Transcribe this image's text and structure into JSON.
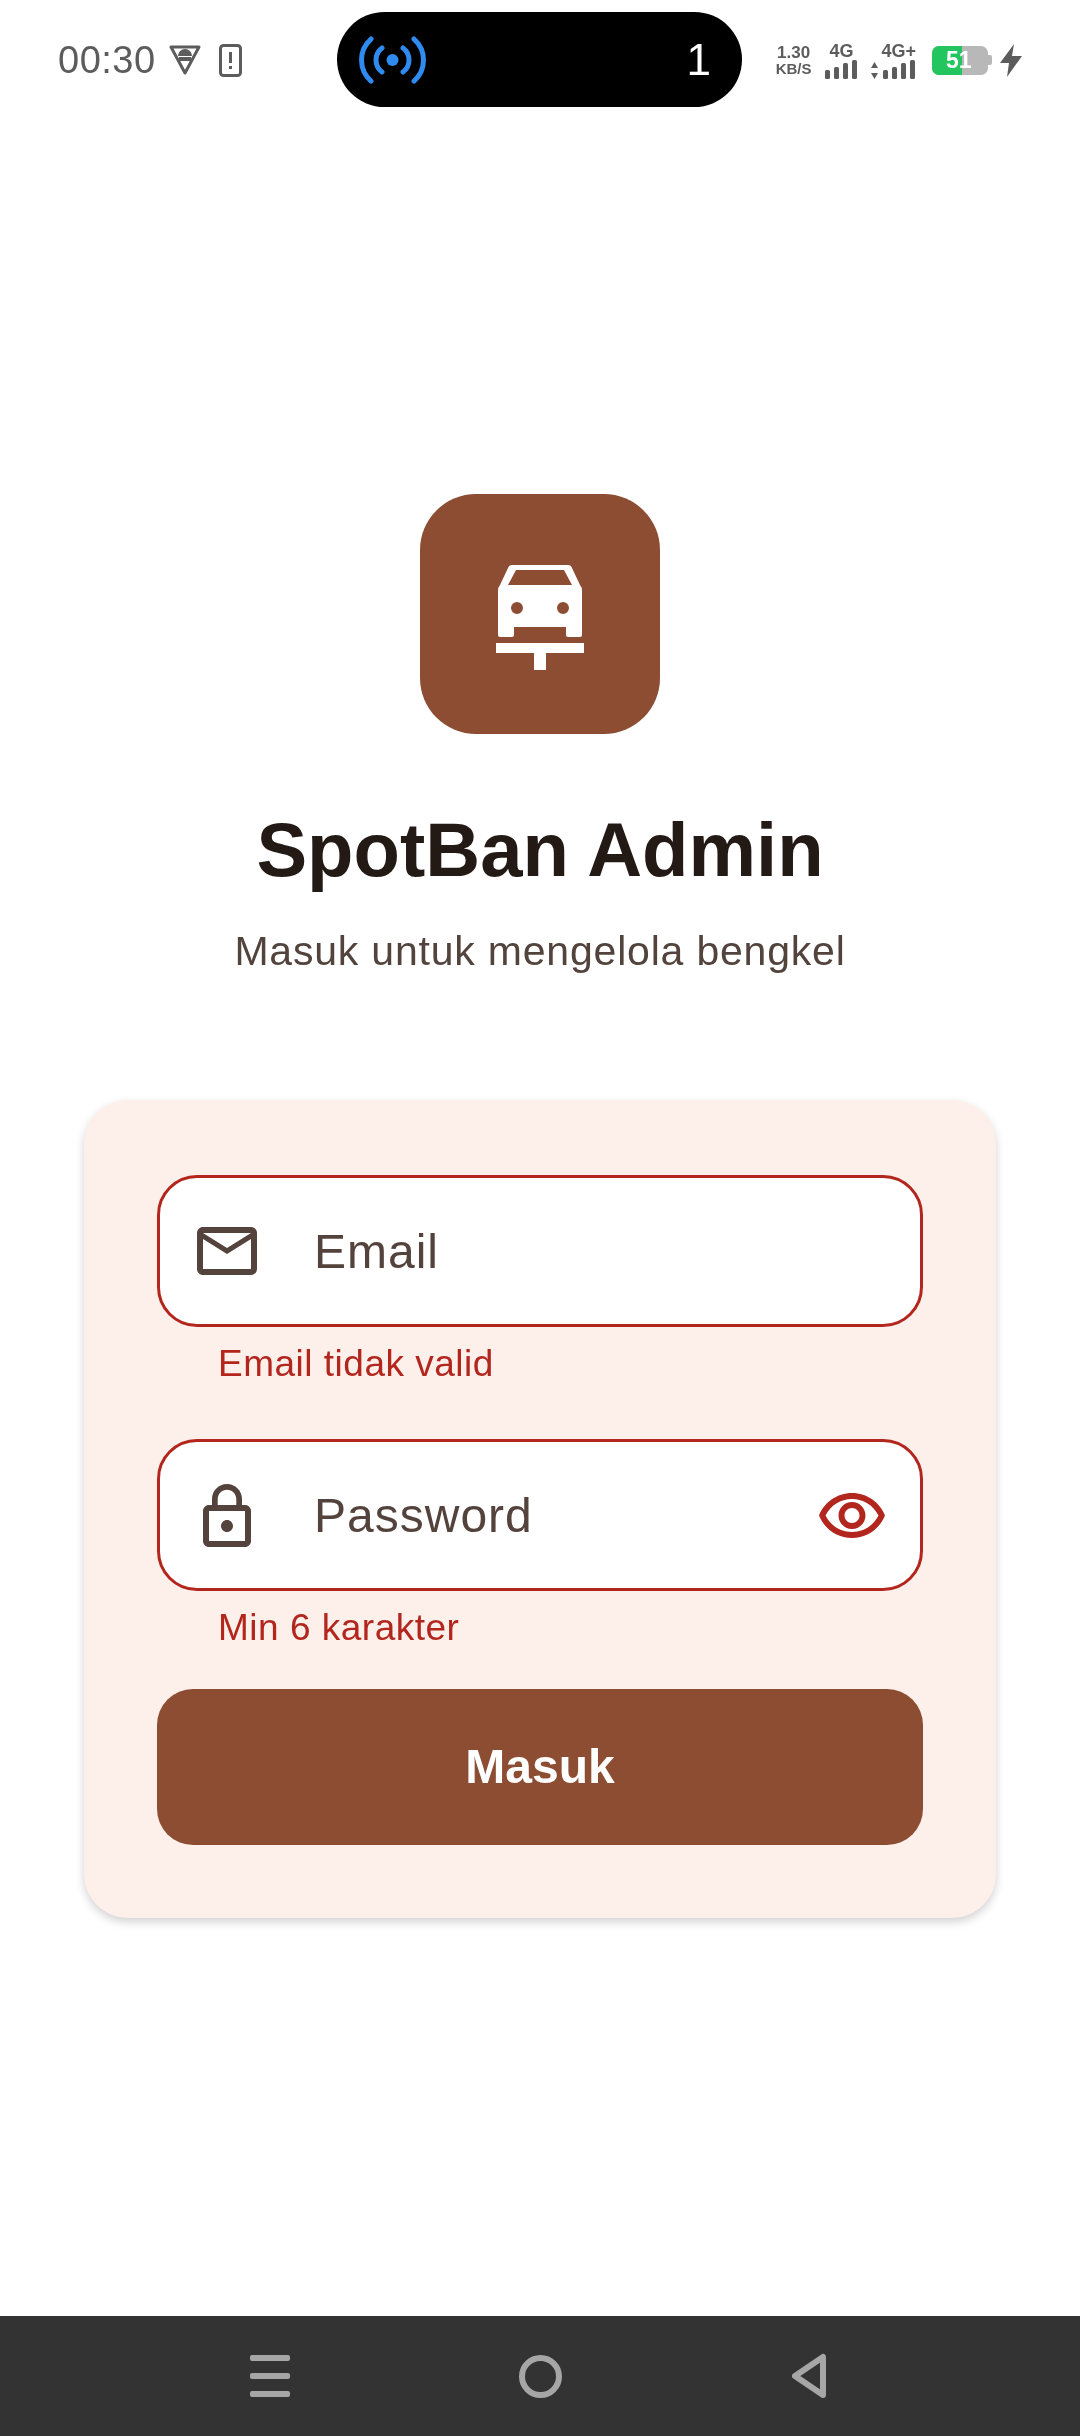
{
  "status_bar": {
    "time": "00:30",
    "pill_count": "1",
    "net_speed": "1.30",
    "net_unit": "KB/S",
    "signals": [
      {
        "label": "4G",
        "arrows": false
      },
      {
        "label": "4G+",
        "arrows": true
      }
    ],
    "battery": "51",
    "charging": true
  },
  "header": {
    "title": "SpotBan Admin",
    "subtitle": "Masuk untuk mengelola bengkel"
  },
  "form": {
    "fields": [
      {
        "kind": "email",
        "placeholder": "Email",
        "error": "Email tidak valid"
      },
      {
        "kind": "password",
        "placeholder": "Password",
        "error": "Min 6 karakter",
        "show_toggle": true
      }
    ],
    "submit": "Masuk"
  }
}
